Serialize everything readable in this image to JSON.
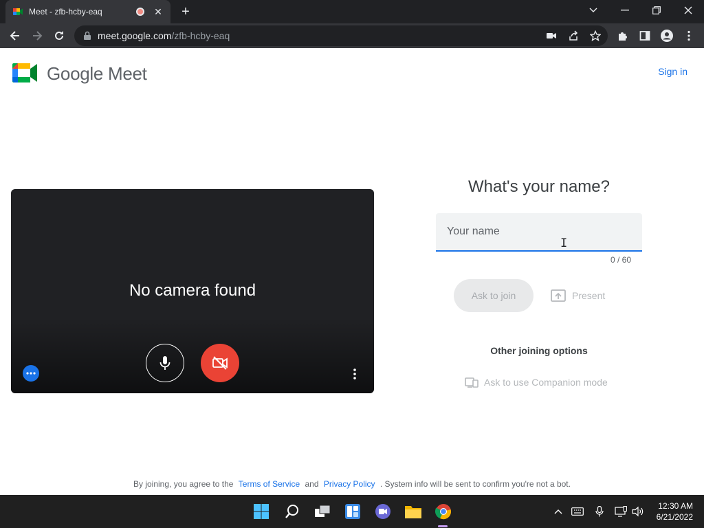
{
  "browser": {
    "tab_title": "Meet - zfb-hcby-eaq",
    "url_host": "meet.google.com",
    "url_path": "/zfb-hcby-eaq"
  },
  "header": {
    "brand": "Google Meet",
    "sign_in": "Sign in"
  },
  "preview": {
    "message": "No camera found"
  },
  "join": {
    "title": "What's your name?",
    "name_placeholder": "Your name",
    "name_value": "",
    "counter": "0 / 60",
    "ask_to_join": "Ask to join",
    "present": "Present",
    "other_options": "Other joining options",
    "companion": "Ask to use Companion mode"
  },
  "footer": {
    "prefix": "By joining, you agree to the",
    "terms": "Terms of Service",
    "and": "and",
    "privacy": "Privacy Policy",
    "suffix": ". System info will be sent to confirm you're not a bot."
  },
  "taskbar": {
    "time": "12:30 AM",
    "date": "6/21/2022"
  },
  "colors": {
    "accent": "#1a73e8",
    "danger": "#ea4335",
    "dark_surface": "#202124"
  }
}
